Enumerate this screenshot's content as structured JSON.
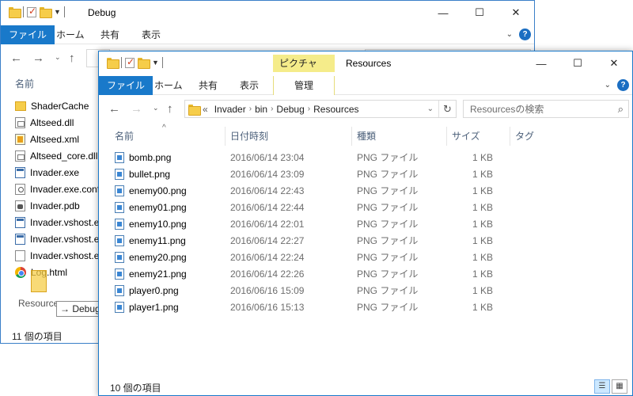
{
  "back_window": {
    "title": "Debug",
    "ribbon_tabs": [
      "ファイル",
      "ホーム",
      "共有",
      "表示"
    ],
    "column_name": "名前",
    "files": [
      {
        "name": "ShaderCache",
        "icon": "folder-icon",
        "kind": "folder"
      },
      {
        "name": "Altseed.dll",
        "icon": "dll-file-icon",
        "kind": "dll"
      },
      {
        "name": "Altseed.xml",
        "icon": "xml-file-icon",
        "kind": "xml"
      },
      {
        "name": "Altseed_core.dll",
        "icon": "dll-file-icon",
        "kind": "dll"
      },
      {
        "name": "Invader.exe",
        "icon": "exe-file-icon",
        "kind": "exe"
      },
      {
        "name": "Invader.exe.config",
        "icon": "config-file-icon",
        "kind": "config"
      },
      {
        "name": "Invader.pdb",
        "icon": "pdb-file-icon",
        "kind": "pdb"
      },
      {
        "name": "Invader.vshost.exe",
        "icon": "exe-file-icon",
        "kind": "exe"
      },
      {
        "name": "Invader.vshost.exe.config",
        "icon": "exe-file-icon",
        "kind": "exe"
      },
      {
        "name": "Invader.vshost.exe.manifest",
        "icon": "file-icon",
        "kind": "file"
      },
      {
        "name": "Log.html",
        "icon": "chrome-icon",
        "kind": "chrome"
      }
    ],
    "drag_label": "Resource",
    "drag_tooltip": "Debug",
    "status": "11 個の項目"
  },
  "front_window": {
    "title": "Resources",
    "context_group": "ピクチャ ツール",
    "ribbon_tabs": [
      "ファイル",
      "ホーム",
      "共有",
      "表示",
      "管理"
    ],
    "breadcrumb": [
      "Invader",
      "bin",
      "Debug",
      "Resources"
    ],
    "breadcrumb_overflow": "«",
    "search_placeholder": "Resourcesの検索",
    "columns": {
      "name": "名前",
      "date": "日付時刻",
      "type": "種類",
      "size": "サイズ",
      "tag": "タグ"
    },
    "files": [
      {
        "name": "bomb.png",
        "date": "2016/06/14 23:04",
        "type": "PNG ファイル",
        "size": "1 KB"
      },
      {
        "name": "bullet.png",
        "date": "2016/06/14 23:09",
        "type": "PNG ファイル",
        "size": "1 KB"
      },
      {
        "name": "enemy00.png",
        "date": "2016/06/14 22:43",
        "type": "PNG ファイル",
        "size": "1 KB"
      },
      {
        "name": "enemy01.png",
        "date": "2016/06/14 22:44",
        "type": "PNG ファイル",
        "size": "1 KB"
      },
      {
        "name": "enemy10.png",
        "date": "2016/06/14 22:01",
        "type": "PNG ファイル",
        "size": "1 KB"
      },
      {
        "name": "enemy11.png",
        "date": "2016/06/14 22:27",
        "type": "PNG ファイル",
        "size": "1 KB"
      },
      {
        "name": "enemy20.png",
        "date": "2016/06/14 22:24",
        "type": "PNG ファイル",
        "size": "1 KB"
      },
      {
        "name": "enemy21.png",
        "date": "2016/06/14 22:26",
        "type": "PNG ファイル",
        "size": "1 KB"
      },
      {
        "name": "player0.png",
        "date": "2016/06/16 15:09",
        "type": "PNG ファイル",
        "size": "1 KB"
      },
      {
        "name": "player1.png",
        "date": "2016/06/16 15:13",
        "type": "PNG ファイル",
        "size": "1 KB"
      }
    ],
    "status": "10 個の項目"
  },
  "colors": {
    "accent": "#1979ca",
    "context_tab": "#f5ec8a",
    "folder": "#f6cd4a"
  }
}
